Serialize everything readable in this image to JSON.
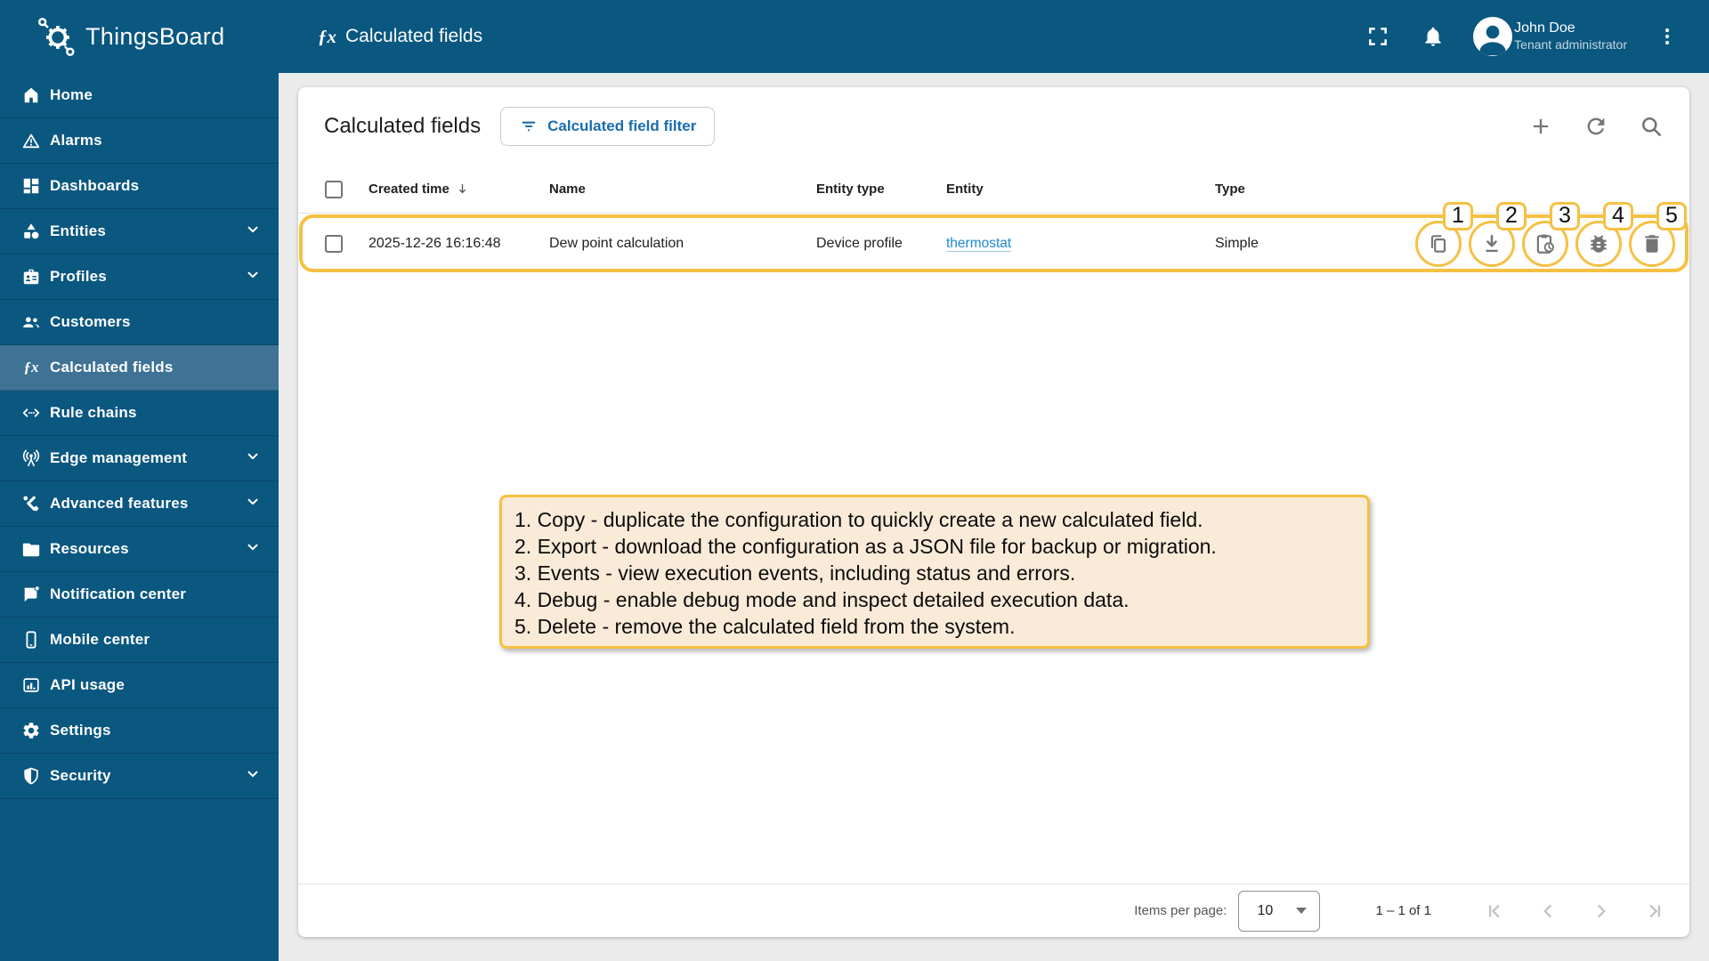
{
  "app": {
    "name": "ThingsBoard"
  },
  "header": {
    "page_title": "Calculated fields",
    "page_title_icon": "fx-icon",
    "icons": [
      "fullscreen-icon",
      "bell-icon",
      "more-vert-icon"
    ],
    "user": {
      "name": "John Doe",
      "role": "Tenant administrator",
      "avatar_icon": "person-avatar-icon"
    }
  },
  "sidebar": {
    "items": [
      {
        "label": "Home",
        "icon": "home-icon",
        "active": false,
        "expandable": false
      },
      {
        "label": "Alarms",
        "icon": "alarm-warning-icon",
        "active": false,
        "expandable": false
      },
      {
        "label": "Dashboards",
        "icon": "dashboards-icon",
        "active": false,
        "expandable": false
      },
      {
        "label": "Entities",
        "icon": "entities-category-icon",
        "active": false,
        "expandable": true
      },
      {
        "label": "Profiles",
        "icon": "profiles-badge-icon",
        "active": false,
        "expandable": true
      },
      {
        "label": "Customers",
        "icon": "customers-people-icon",
        "active": false,
        "expandable": false
      },
      {
        "label": "Calculated fields",
        "icon": "fx-icon",
        "active": true,
        "expandable": false
      },
      {
        "label": "Rule chains",
        "icon": "rule-chains-icon",
        "active": false,
        "expandable": false
      },
      {
        "label": "Edge management",
        "icon": "edge-antenna-icon",
        "active": false,
        "expandable": true
      },
      {
        "label": "Advanced features",
        "icon": "advanced-tools-icon",
        "active": false,
        "expandable": true
      },
      {
        "label": "Resources",
        "icon": "folder-icon",
        "active": false,
        "expandable": true
      },
      {
        "label": "Notification center",
        "icon": "notification-message-icon",
        "active": false,
        "expandable": false
      },
      {
        "label": "Mobile center",
        "icon": "mobile-phone-icon",
        "active": false,
        "expandable": false
      },
      {
        "label": "API usage",
        "icon": "api-usage-chart-icon",
        "active": false,
        "expandable": false
      },
      {
        "label": "Settings",
        "icon": "gear-icon",
        "active": false,
        "expandable": false
      },
      {
        "label": "Security",
        "icon": "shield-icon",
        "active": false,
        "expandable": true
      }
    ]
  },
  "content": {
    "title": "Calculated fields",
    "filter_button": {
      "label": "Calculated field filter",
      "icon": "filter-icon"
    },
    "toolbar_icons": [
      "add-plus-icon",
      "refresh-icon",
      "search-icon"
    ],
    "table": {
      "headers": [
        "Created time",
        "Name",
        "Entity type",
        "Entity",
        "Type"
      ],
      "sort_column": "Created time",
      "sort_icon": "arrow-down-icon",
      "rows": [
        {
          "created_time": "2025-12-26 16:16:48",
          "name": "Dew point calculation",
          "entity_type": "Device profile",
          "entity": "thermostat",
          "type": "Simple"
        }
      ]
    },
    "actions": [
      {
        "number": "1",
        "name": "copy",
        "icon": "copy-icon"
      },
      {
        "number": "2",
        "name": "export",
        "icon": "download-icon"
      },
      {
        "number": "3",
        "name": "events",
        "icon": "events-clipboard-clock-icon"
      },
      {
        "number": "4",
        "name": "debug",
        "icon": "bug-icon"
      },
      {
        "number": "5",
        "name": "delete",
        "icon": "trash-icon"
      }
    ],
    "notes": {
      "lines": [
        "1. Copy - duplicate the configuration to quickly create a new calculated field.",
        "2. Export -  download the configuration as a JSON file for backup or migration.",
        "3. Events - view execution events, including status and errors.",
        "4. Debug - enable debug mode and inspect detailed execution data.",
        "5. Delete - remove the calculated field from the system."
      ]
    }
  },
  "pagination": {
    "items_per_page_label": "Items per page:",
    "page_size": "10",
    "range": "1 – 1 of 1",
    "nav_icons": [
      "first-page-icon",
      "prev-page-icon",
      "next-page-icon",
      "last-page-icon"
    ]
  },
  "colors": {
    "primary": "#0a5780",
    "sidebar_active": "#3e7396",
    "annotation_yellow": "#f5c143",
    "annotation_bg": "#faebd8",
    "link_blue": "#1e88d2",
    "button_blue": "#1a6dae",
    "icon_gray": "#757575"
  }
}
